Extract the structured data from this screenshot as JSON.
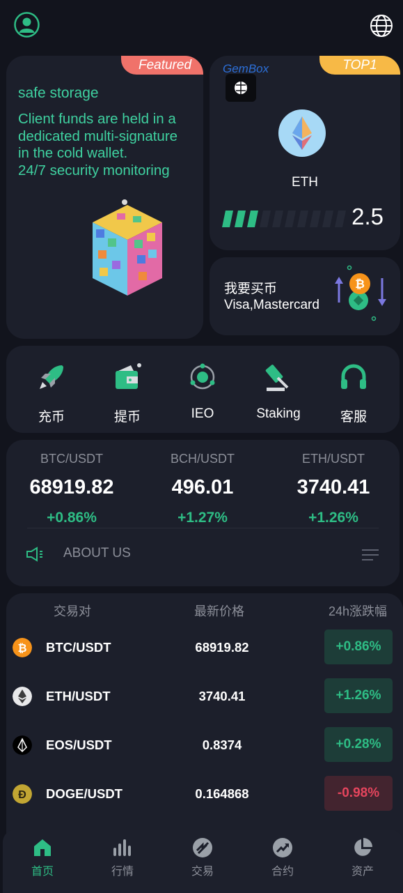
{
  "header": {
    "avatar_icon": "user-avatar-icon",
    "globe_icon": "globe-icon"
  },
  "featured": {
    "ribbon": "Featured",
    "title": "safe storage",
    "text": "Client funds are held in a\ndedicated multi-signature\n in the cold wallet.\n24/7 security monitoring"
  },
  "gem": {
    "brand": "GemBox",
    "ribbon": "TOP1",
    "coin": "ETH",
    "value": "2.5",
    "bar_filled": 3,
    "bar_total": 10
  },
  "buy": {
    "title": "我要买币",
    "subtitle": "Visa,Mastercard"
  },
  "actions": [
    {
      "label": "充币",
      "icon": "rocket-icon"
    },
    {
      "label": "提币",
      "icon": "wallet-icon"
    },
    {
      "label": "IEO",
      "icon": "orbit-icon"
    },
    {
      "label": "Staking",
      "icon": "gavel-icon"
    },
    {
      "label": "客服",
      "icon": "headset-icon"
    }
  ],
  "tickers": [
    {
      "pair": "BTC/USDT",
      "price": "68919.82",
      "change": "+0.86%"
    },
    {
      "pair": "BCH/USDT",
      "price": "496.01",
      "change": "+1.27%"
    },
    {
      "pair": "ETH/USDT",
      "price": "3740.41",
      "change": "+1.26%"
    }
  ],
  "about": {
    "label": "ABOUT US"
  },
  "market": {
    "headers": [
      "交易对",
      "最新价格",
      "24h涨跌幅"
    ],
    "rows": [
      {
        "pair": "BTC/USDT",
        "price": "68919.82",
        "change": "+0.86%",
        "direction": "up",
        "icon": "btc-icon"
      },
      {
        "pair": "ETH/USDT",
        "price": "3740.41",
        "change": "+1.26%",
        "direction": "up",
        "icon": "eth-icon"
      },
      {
        "pair": "EOS/USDT",
        "price": "0.8374",
        "change": "+0.28%",
        "direction": "up",
        "icon": "eos-icon"
      },
      {
        "pair": "DOGE/USDT",
        "price": "0.164868",
        "change": "-0.98%",
        "direction": "down",
        "icon": "doge-icon"
      }
    ]
  },
  "nav": [
    {
      "label": "首页",
      "icon": "home-icon",
      "active": true
    },
    {
      "label": "行情",
      "icon": "bar-chart-icon",
      "active": false
    },
    {
      "label": "交易",
      "icon": "trade-icon",
      "active": false
    },
    {
      "label": "合约",
      "icon": "trend-icon",
      "active": false
    },
    {
      "label": "资产",
      "icon": "pie-chart-icon",
      "active": false
    }
  ],
  "colors": {
    "background": "#12141d",
    "card": "#1c1f2b",
    "accent_green": "#2ebd85",
    "accent_red": "#e5455d",
    "featured_ribbon": "#f0726a",
    "top1_ribbon": "#f7b946"
  }
}
